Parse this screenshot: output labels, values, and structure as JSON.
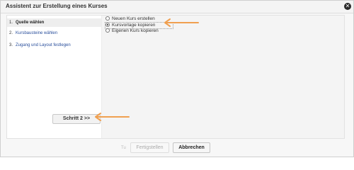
{
  "window": {
    "title": "Assistent zur Erstellung eines Kurses",
    "close_glyph": "✕"
  },
  "steps": [
    {
      "num": "1.",
      "label": "Quelle wählen",
      "active": true
    },
    {
      "num": "2.",
      "label": "Kursbausteine wählen",
      "active": false
    },
    {
      "num": "3.",
      "label": "Zugang und Layout festlegen",
      "active": false
    }
  ],
  "options": [
    {
      "label": "Neuen Kurs erstellen",
      "selected": false
    },
    {
      "label": "Kursvorlage kopieren",
      "selected": true
    },
    {
      "label": "Eigenen Kurs kopieren",
      "selected": false
    }
  ],
  "next_button": "Schritt 2 >>",
  "footer": {
    "hint": "Tu",
    "finish_label": "Fertigstellen",
    "cancel_label": "Abbrechen"
  },
  "annotations": {
    "arrow_color": "#f0a050"
  }
}
